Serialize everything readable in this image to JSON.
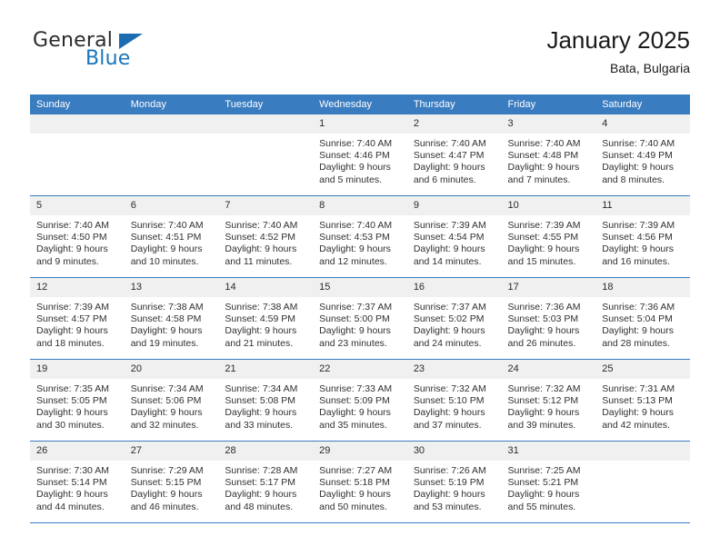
{
  "brand": {
    "name_part1": "General",
    "name_part2": "Blue",
    "triangle_color": "#1b6cb0",
    "blue_color": "#1b75bb"
  },
  "header": {
    "title": "January 2025",
    "subtitle": "Bata, Bulgaria"
  },
  "colors": {
    "header_blue": "#3a7cc0",
    "daynum_band": "#f0f0f0",
    "text": "#303030"
  },
  "weekday_headers": [
    "Sunday",
    "Monday",
    "Tuesday",
    "Wednesday",
    "Thursday",
    "Friday",
    "Saturday"
  ],
  "weeks": [
    [
      {
        "day": "",
        "sunrise": "",
        "sunset": "",
        "daylight1": "",
        "daylight2": ""
      },
      {
        "day": "",
        "sunrise": "",
        "sunset": "",
        "daylight1": "",
        "daylight2": ""
      },
      {
        "day": "",
        "sunrise": "",
        "sunset": "",
        "daylight1": "",
        "daylight2": ""
      },
      {
        "day": "1",
        "sunrise": "Sunrise: 7:40 AM",
        "sunset": "Sunset: 4:46 PM",
        "daylight1": "Daylight: 9 hours",
        "daylight2": "and 5 minutes."
      },
      {
        "day": "2",
        "sunrise": "Sunrise: 7:40 AM",
        "sunset": "Sunset: 4:47 PM",
        "daylight1": "Daylight: 9 hours",
        "daylight2": "and 6 minutes."
      },
      {
        "day": "3",
        "sunrise": "Sunrise: 7:40 AM",
        "sunset": "Sunset: 4:48 PM",
        "daylight1": "Daylight: 9 hours",
        "daylight2": "and 7 minutes."
      },
      {
        "day": "4",
        "sunrise": "Sunrise: 7:40 AM",
        "sunset": "Sunset: 4:49 PM",
        "daylight1": "Daylight: 9 hours",
        "daylight2": "and 8 minutes."
      }
    ],
    [
      {
        "day": "5",
        "sunrise": "Sunrise: 7:40 AM",
        "sunset": "Sunset: 4:50 PM",
        "daylight1": "Daylight: 9 hours",
        "daylight2": "and 9 minutes."
      },
      {
        "day": "6",
        "sunrise": "Sunrise: 7:40 AM",
        "sunset": "Sunset: 4:51 PM",
        "daylight1": "Daylight: 9 hours",
        "daylight2": "and 10 minutes."
      },
      {
        "day": "7",
        "sunrise": "Sunrise: 7:40 AM",
        "sunset": "Sunset: 4:52 PM",
        "daylight1": "Daylight: 9 hours",
        "daylight2": "and 11 minutes."
      },
      {
        "day": "8",
        "sunrise": "Sunrise: 7:40 AM",
        "sunset": "Sunset: 4:53 PM",
        "daylight1": "Daylight: 9 hours",
        "daylight2": "and 12 minutes."
      },
      {
        "day": "9",
        "sunrise": "Sunrise: 7:39 AM",
        "sunset": "Sunset: 4:54 PM",
        "daylight1": "Daylight: 9 hours",
        "daylight2": "and 14 minutes."
      },
      {
        "day": "10",
        "sunrise": "Sunrise: 7:39 AM",
        "sunset": "Sunset: 4:55 PM",
        "daylight1": "Daylight: 9 hours",
        "daylight2": "and 15 minutes."
      },
      {
        "day": "11",
        "sunrise": "Sunrise: 7:39 AM",
        "sunset": "Sunset: 4:56 PM",
        "daylight1": "Daylight: 9 hours",
        "daylight2": "and 16 minutes."
      }
    ],
    [
      {
        "day": "12",
        "sunrise": "Sunrise: 7:39 AM",
        "sunset": "Sunset: 4:57 PM",
        "daylight1": "Daylight: 9 hours",
        "daylight2": "and 18 minutes."
      },
      {
        "day": "13",
        "sunrise": "Sunrise: 7:38 AM",
        "sunset": "Sunset: 4:58 PM",
        "daylight1": "Daylight: 9 hours",
        "daylight2": "and 19 minutes."
      },
      {
        "day": "14",
        "sunrise": "Sunrise: 7:38 AM",
        "sunset": "Sunset: 4:59 PM",
        "daylight1": "Daylight: 9 hours",
        "daylight2": "and 21 minutes."
      },
      {
        "day": "15",
        "sunrise": "Sunrise: 7:37 AM",
        "sunset": "Sunset: 5:00 PM",
        "daylight1": "Daylight: 9 hours",
        "daylight2": "and 23 minutes."
      },
      {
        "day": "16",
        "sunrise": "Sunrise: 7:37 AM",
        "sunset": "Sunset: 5:02 PM",
        "daylight1": "Daylight: 9 hours",
        "daylight2": "and 24 minutes."
      },
      {
        "day": "17",
        "sunrise": "Sunrise: 7:36 AM",
        "sunset": "Sunset: 5:03 PM",
        "daylight1": "Daylight: 9 hours",
        "daylight2": "and 26 minutes."
      },
      {
        "day": "18",
        "sunrise": "Sunrise: 7:36 AM",
        "sunset": "Sunset: 5:04 PM",
        "daylight1": "Daylight: 9 hours",
        "daylight2": "and 28 minutes."
      }
    ],
    [
      {
        "day": "19",
        "sunrise": "Sunrise: 7:35 AM",
        "sunset": "Sunset: 5:05 PM",
        "daylight1": "Daylight: 9 hours",
        "daylight2": "and 30 minutes."
      },
      {
        "day": "20",
        "sunrise": "Sunrise: 7:34 AM",
        "sunset": "Sunset: 5:06 PM",
        "daylight1": "Daylight: 9 hours",
        "daylight2": "and 32 minutes."
      },
      {
        "day": "21",
        "sunrise": "Sunrise: 7:34 AM",
        "sunset": "Sunset: 5:08 PM",
        "daylight1": "Daylight: 9 hours",
        "daylight2": "and 33 minutes."
      },
      {
        "day": "22",
        "sunrise": "Sunrise: 7:33 AM",
        "sunset": "Sunset: 5:09 PM",
        "daylight1": "Daylight: 9 hours",
        "daylight2": "and 35 minutes."
      },
      {
        "day": "23",
        "sunrise": "Sunrise: 7:32 AM",
        "sunset": "Sunset: 5:10 PM",
        "daylight1": "Daylight: 9 hours",
        "daylight2": "and 37 minutes."
      },
      {
        "day": "24",
        "sunrise": "Sunrise: 7:32 AM",
        "sunset": "Sunset: 5:12 PM",
        "daylight1": "Daylight: 9 hours",
        "daylight2": "and 39 minutes."
      },
      {
        "day": "25",
        "sunrise": "Sunrise: 7:31 AM",
        "sunset": "Sunset: 5:13 PM",
        "daylight1": "Daylight: 9 hours",
        "daylight2": "and 42 minutes."
      }
    ],
    [
      {
        "day": "26",
        "sunrise": "Sunrise: 7:30 AM",
        "sunset": "Sunset: 5:14 PM",
        "daylight1": "Daylight: 9 hours",
        "daylight2": "and 44 minutes."
      },
      {
        "day": "27",
        "sunrise": "Sunrise: 7:29 AM",
        "sunset": "Sunset: 5:15 PM",
        "daylight1": "Daylight: 9 hours",
        "daylight2": "and 46 minutes."
      },
      {
        "day": "28",
        "sunrise": "Sunrise: 7:28 AM",
        "sunset": "Sunset: 5:17 PM",
        "daylight1": "Daylight: 9 hours",
        "daylight2": "and 48 minutes."
      },
      {
        "day": "29",
        "sunrise": "Sunrise: 7:27 AM",
        "sunset": "Sunset: 5:18 PM",
        "daylight1": "Daylight: 9 hours",
        "daylight2": "and 50 minutes."
      },
      {
        "day": "30",
        "sunrise": "Sunrise: 7:26 AM",
        "sunset": "Sunset: 5:19 PM",
        "daylight1": "Daylight: 9 hours",
        "daylight2": "and 53 minutes."
      },
      {
        "day": "31",
        "sunrise": "Sunrise: 7:25 AM",
        "sunset": "Sunset: 5:21 PM",
        "daylight1": "Daylight: 9 hours",
        "daylight2": "and 55 minutes."
      },
      {
        "day": "",
        "sunrise": "",
        "sunset": "",
        "daylight1": "",
        "daylight2": ""
      }
    ]
  ]
}
